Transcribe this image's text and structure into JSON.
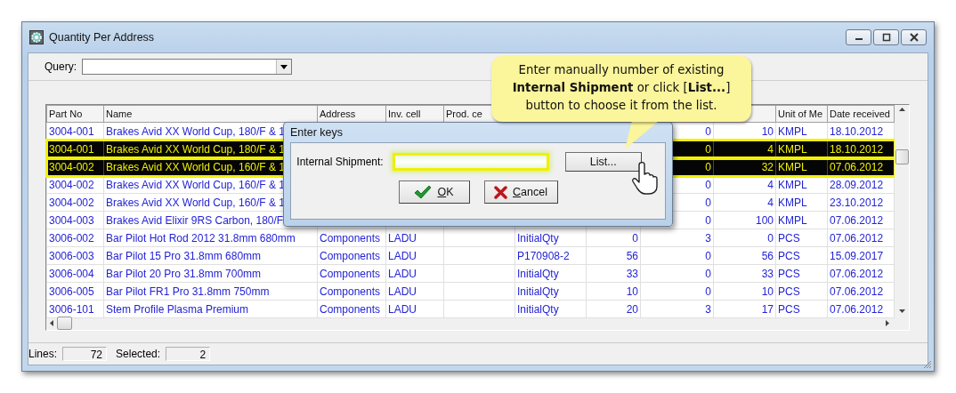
{
  "window": {
    "title": "Quantity Per Address"
  },
  "query": {
    "label": "Query:"
  },
  "table": {
    "columns_left": [
      "Part No",
      "Name",
      "Address",
      "Inv. cell",
      "Prod. ce"
    ],
    "columns_right": [
      "Unit of Me",
      "Date received"
    ],
    "rows": [
      {
        "selected": false,
        "part_no": "3004-001",
        "name": "Brakes Avid XX World Cup, 180/F & 1",
        "column_8": "0",
        "column_9": "10",
        "unit": "KMPL",
        "date": "18.10.2012"
      },
      {
        "selected": true,
        "part_no": "3004-001",
        "name": "Brakes Avid XX World Cup, 180/F & 1",
        "column_8": "0",
        "column_9": "4",
        "unit": "KMPL",
        "date": "18.10.2012"
      },
      {
        "selected": true,
        "part_no": "3004-002",
        "name": "Brakes Avid XX World Cup, 160/F & 1",
        "column_8": "0",
        "column_9": "32",
        "unit": "KMPL",
        "date": "07.06.2012"
      },
      {
        "selected": false,
        "part_no": "3004-002",
        "name": "Brakes Avid XX World Cup, 160/F & 1",
        "column_8": "0",
        "column_9": "4",
        "unit": "KMPL",
        "date": "28.09.2012"
      },
      {
        "selected": false,
        "part_no": "3004-002",
        "name": "Brakes Avid XX World Cup, 160/F & 1",
        "column_8": "0",
        "column_9": "4",
        "unit": "KMPL",
        "date": "23.10.2012"
      },
      {
        "selected": false,
        "part_no": "3004-003",
        "name": "Brakes Avid Elixir 9RS Carbon, 180/F",
        "column_8": "0",
        "column_9": "100",
        "unit": "KMPL",
        "date": "07.06.2012"
      },
      {
        "selected": false,
        "part_no": "3006-002",
        "name": "Bar Pilot Hot Rod 2012 31.8mm 680mm",
        "address": "Components",
        "inv_cell": "LADU",
        "column_6": "InitialQty",
        "column_7": "0",
        "column_8": "3",
        "column_9": "0",
        "unit": "PCS",
        "date": "07.06.2012"
      },
      {
        "selected": false,
        "part_no": "3006-003",
        "name": "Bar Pilot 15 Pro 31.8mm 680mm",
        "address": "Components",
        "inv_cell": "LADU",
        "column_6": "P170908-2",
        "column_7": "56",
        "column_8": "0",
        "column_9": "56",
        "unit": "PCS",
        "date": "15.09.2017"
      },
      {
        "selected": false,
        "part_no": "3006-004",
        "name": "Bar Pilot 20 Pro 31.8mm 700mm",
        "address": "Components",
        "inv_cell": "LADU",
        "column_6": "InitialQty",
        "column_7": "33",
        "column_8": "0",
        "column_9": "33",
        "unit": "PCS",
        "date": "07.06.2012"
      },
      {
        "selected": false,
        "part_no": "3006-005",
        "name": "Bar Pilot FR1 Pro 31.8mm 750mm",
        "address": "Components",
        "inv_cell": "LADU",
        "column_6": "InitialQty",
        "column_7": "10",
        "column_8": "0",
        "column_9": "10",
        "unit": "PCS",
        "date": "07.06.2012"
      },
      {
        "selected": false,
        "part_no": "3006-101",
        "name": "Stem Profile Plasma Premium",
        "address": "Components",
        "inv_cell": "LADU",
        "column_6": "InitialQty",
        "column_7": "20",
        "column_8": "3",
        "column_9": "17",
        "unit": "PCS",
        "date": "07.06.2012"
      }
    ]
  },
  "status_bar": {
    "lines_label": "Lines:",
    "lines": "72",
    "selected_label": "Selected:",
    "selected": "2"
  },
  "dialog": {
    "title": "Enter keys",
    "field_label": "Internal Shipment:",
    "list_button": "List...",
    "ok_button": "OK",
    "cancel_button": "Cancel"
  },
  "callout": {
    "text": "Enter manually number of existing **Internal Shipment** or click [**List...**] button to choose it from the list."
  }
}
